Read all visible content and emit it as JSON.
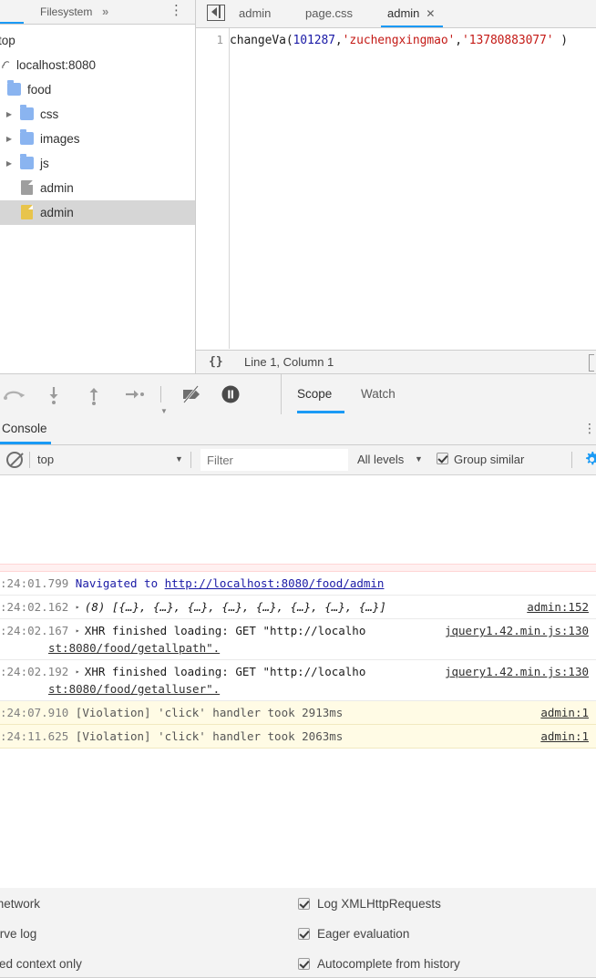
{
  "navigator": {
    "tab_label": "Filesystem",
    "more_tabs_icon": "chevrons-right-icon",
    "menu_icon": "more-vertical-icon",
    "tree": [
      {
        "label": "top",
        "type": "root",
        "indent": 0,
        "twisty": "",
        "icon": "none"
      },
      {
        "label": "localhost:8080",
        "type": "origin",
        "indent": 1,
        "twisty": "",
        "icon": "cloud-icon"
      },
      {
        "label": "food",
        "type": "folder",
        "indent": 2,
        "twisty": "",
        "icon": "folder-icon"
      },
      {
        "label": "css",
        "type": "folder",
        "indent": 3,
        "twisty": "▶",
        "icon": "folder-icon"
      },
      {
        "label": "images",
        "type": "folder",
        "indent": 3,
        "twisty": "▶",
        "icon": "folder-icon"
      },
      {
        "label": "js",
        "type": "folder",
        "indent": 3,
        "twisty": "▶",
        "icon": "folder-icon"
      },
      {
        "label": "admin",
        "type": "file",
        "indent": 3,
        "twisty": "",
        "icon": "file-icon"
      },
      {
        "label": "admin",
        "type": "file-selected",
        "indent": 3,
        "twisty": "",
        "icon": "file-yellow-icon"
      }
    ]
  },
  "editor": {
    "nav_toggle_icon": "show-navigator-icon",
    "tabs": [
      {
        "label": "admin",
        "active": false,
        "closable": false
      },
      {
        "label": "page.css",
        "active": false,
        "closable": false
      },
      {
        "label": "admin",
        "active": true,
        "closable": true,
        "close_icon": "close-icon"
      }
    ],
    "line_number": "1",
    "code_tokens": [
      {
        "text": "changeVa(",
        "kind": "plain"
      },
      {
        "text": "101287",
        "kind": "number"
      },
      {
        "text": ",",
        "kind": "plain"
      },
      {
        "text": "'zuchengxingmao'",
        "kind": "string"
      },
      {
        "text": ",",
        "kind": "plain"
      },
      {
        "text": "'13780883077'",
        "kind": "string"
      },
      {
        "text": " )",
        "kind": "plain"
      }
    ],
    "status": {
      "format_icon": "{}",
      "position": "Line 1, Column 1"
    }
  },
  "debugger": {
    "buttons": [
      {
        "name": "resume-script-icon",
        "title": "Resume"
      },
      {
        "name": "step-over-icon",
        "title": "Step over"
      },
      {
        "name": "step-into-icon",
        "title": "Step into"
      },
      {
        "name": "step-out-icon",
        "title": "Step out"
      },
      {
        "name": "deactivate-breakpoints-icon",
        "title": "Deactivate breakpoints"
      },
      {
        "name": "pause-on-exceptions-icon",
        "title": "Pause on exceptions"
      }
    ],
    "tabs": [
      {
        "label": "Scope",
        "active": true
      },
      {
        "label": "Watch",
        "active": false
      }
    ]
  },
  "console": {
    "tab_label": "Console",
    "menu_icon": "more-vertical-icon",
    "toolbar": {
      "clear_icon": "clear-console-icon",
      "context": "top",
      "context_caret": "▼",
      "filter_placeholder": "Filter",
      "filter_value": "",
      "levels": "All levels",
      "levels_caret": "▼",
      "group_similar_label": "Group similar",
      "group_similar_checked": true,
      "settings_icon": "gear-icon"
    },
    "settings": {
      "left_column": [
        {
          "label": "de network",
          "checked": false
        },
        {
          "label": "eserve log",
          "checked": false
        },
        {
          "label": "lected context only",
          "checked": false
        }
      ],
      "right_column": [
        {
          "label": "Log XMLHttpRequests",
          "checked": true
        },
        {
          "label": "Eager evaluation",
          "checked": true
        },
        {
          "label": "Autocomplete from history",
          "checked": true
        }
      ]
    },
    "messages": [
      {
        "kind": "error-clipped",
        "timestamp": "",
        "text": "",
        "source": ""
      },
      {
        "kind": "info",
        "timestamp": ":24:01.799",
        "prefix": "Navigated to ",
        "link": "http://localhost:8080/food/admin",
        "source": ""
      },
      {
        "kind": "log",
        "timestamp": ":24:02.162",
        "disclosure": "▸",
        "count": "(8)",
        "text": "[{…}, {…}, {…}, {…}, {…}, {…}, {…}, {…}]",
        "source": "admin:152"
      },
      {
        "kind": "log",
        "timestamp": ":24:02.167",
        "disclosure": "▸",
        "text": "XHR finished loading: GET \"http://localho",
        "text_line2": "st:8080/food/getallpath\".",
        "source": "jquery1.42.min.js:130"
      },
      {
        "kind": "log",
        "timestamp": ":24:02.192",
        "disclosure": "▸",
        "text": "XHR finished loading: GET \"http://localho",
        "text_line2": "st:8080/food/getalluser\".",
        "source": "jquery1.42.min.js:130"
      },
      {
        "kind": "warning",
        "timestamp": ":24:07.910",
        "text": "[Violation] 'click' handler took 2913ms",
        "source": "admin:1"
      },
      {
        "kind": "warning",
        "timestamp": ":24:11.625",
        "text": "[Violation] 'click' handler took 2063ms",
        "source": "admin:1"
      }
    ]
  },
  "colors": {
    "accent": "#1a9af5",
    "toolbar_bg": "#f3f3f3",
    "border": "#cdcdcd",
    "selected_row": "#d6d6d6",
    "folder": "#8ab4f0",
    "file": "#9e9e9e",
    "file_selected": "#e8c44c",
    "string_token": "#c41a16",
    "number_token": "#1a1aa6",
    "warning_bg": "#fffbe5",
    "error_bg": "#fff0f0"
  }
}
